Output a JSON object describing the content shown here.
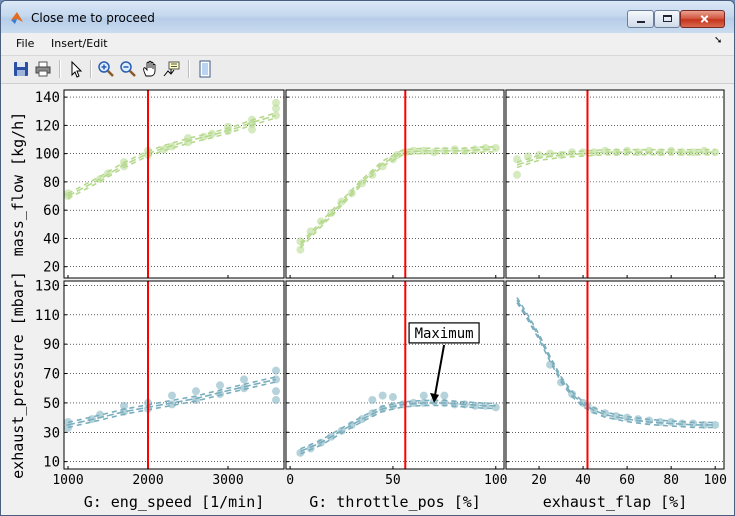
{
  "window": {
    "title": "Close me to proceed"
  },
  "menu": {
    "file": "File",
    "insert_edit": "Insert/Edit",
    "dock_arrow": "➘"
  },
  "toolbar": {
    "icons": [
      "save-icon",
      "print-icon",
      "select-arrow-icon",
      "zoom-in-icon",
      "zoom-out-icon",
      "pan-hand-icon",
      "data-cursor-icon",
      "plot-tools-icon"
    ]
  },
  "colors": {
    "mass_flow": "#b5d98c",
    "exhaust_pressure": "#7aaebe",
    "marker_line": "#ff0000",
    "grid": "#000000"
  },
  "chart_data": [
    {
      "type": "scatter",
      "panel": "top-left",
      "xlabel": "",
      "ylabel": "mass_flow [kg/h]",
      "xlim": [
        950,
        3700
      ],
      "ylim": [
        12,
        145
      ],
      "yticks": [
        20,
        40,
        60,
        80,
        100,
        120,
        140
      ],
      "xticks": [
        1000,
        2000,
        3000
      ],
      "show_xtick_labels": false,
      "marker_x": 2000,
      "series": [
        {
          "x": [
            1000,
            1400,
            1700,
            2000,
            2200,
            2500,
            2800,
            3100,
            3300,
            3600
          ],
          "y": [
            70,
            82,
            92,
            100,
            104,
            109,
            113,
            118,
            122,
            127
          ],
          "kind": "lines"
        }
      ],
      "points": [
        [
          1000,
          70
        ],
        [
          1000,
          72
        ],
        [
          1400,
          82
        ],
        [
          1500,
          86
        ],
        [
          1700,
          91
        ],
        [
          1700,
          94
        ],
        [
          2000,
          99
        ],
        [
          2000,
          102
        ],
        [
          2200,
          103
        ],
        [
          2300,
          105
        ],
        [
          2500,
          108
        ],
        [
          2500,
          111
        ],
        [
          2700,
          112
        ],
        [
          2800,
          114
        ],
        [
          3000,
          116
        ],
        [
          3000,
          119
        ],
        [
          3300,
          121
        ],
        [
          3300,
          124
        ],
        [
          3600,
          127
        ],
        [
          3600,
          132
        ],
        [
          3600,
          136
        ],
        [
          3300,
          117
        ]
      ]
    },
    {
      "type": "scatter",
      "panel": "top-middle",
      "xlabel": "",
      "ylabel": "",
      "xlim": [
        -2,
        104
      ],
      "ylim": [
        12,
        145
      ],
      "xticks": [
        0,
        50,
        100
      ],
      "show_xtick_labels": false,
      "marker_x": 56,
      "series": [
        {
          "x": [
            5,
            15,
            25,
            35,
            45,
            55,
            65,
            75,
            85,
            95,
            100
          ],
          "y": [
            35,
            50,
            65,
            80,
            93,
            101,
            102,
            102,
            102,
            103,
            103
          ],
          "kind": "lines"
        }
      ],
      "points": [
        [
          5,
          32
        ],
        [
          5,
          38
        ],
        [
          10,
          45
        ],
        [
          15,
          52
        ],
        [
          20,
          58
        ],
        [
          25,
          66
        ],
        [
          30,
          72
        ],
        [
          35,
          79
        ],
        [
          40,
          85
        ],
        [
          45,
          91
        ],
        [
          50,
          96
        ],
        [
          52,
          99
        ],
        [
          56,
          101
        ],
        [
          60,
          102
        ],
        [
          65,
          102
        ],
        [
          70,
          101
        ],
        [
          75,
          102
        ],
        [
          80,
          103
        ],
        [
          85,
          102
        ],
        [
          90,
          103
        ],
        [
          95,
          104
        ],
        [
          100,
          104
        ]
      ]
    },
    {
      "type": "scatter",
      "panel": "top-right",
      "xlabel": "",
      "ylabel": "",
      "xlim": [
        5,
        104
      ],
      "ylim": [
        12,
        145
      ],
      "xticks": [
        20,
        40,
        60,
        80,
        100
      ],
      "show_xtick_labels": false,
      "marker_x": 42,
      "series": [
        {
          "x": [
            10,
            20,
            30,
            40,
            50,
            60,
            70,
            80,
            90,
            100
          ],
          "y": [
            92,
            97,
            99,
            100,
            101,
            101,
            101,
            101,
            101,
            101
          ],
          "kind": "lines"
        }
      ],
      "points": [
        [
          10,
          85
        ],
        [
          10,
          96
        ],
        [
          15,
          98
        ],
        [
          20,
          99
        ],
        [
          25,
          100
        ],
        [
          30,
          99
        ],
        [
          35,
          101
        ],
        [
          40,
          101
        ],
        [
          45,
          101
        ],
        [
          50,
          102
        ],
        [
          55,
          101
        ],
        [
          60,
          102
        ],
        [
          65,
          101
        ],
        [
          70,
          102
        ],
        [
          75,
          101
        ],
        [
          80,
          102
        ],
        [
          85,
          101
        ],
        [
          90,
          101
        ],
        [
          95,
          102
        ],
        [
          100,
          101
        ]
      ]
    },
    {
      "type": "scatter",
      "panel": "bottom-left",
      "xlabel": "G: eng_speed [1/min]",
      "ylabel": "exhaust_pressure [mbar]",
      "xlim": [
        950,
        3700
      ],
      "ylim": [
        5,
        133
      ],
      "yticks": [
        10,
        30,
        50,
        70,
        90,
        110,
        130
      ],
      "xticks": [
        1000,
        2000,
        3000
      ],
      "xtick_labels": [
        "1000",
        "2000",
        "3000"
      ],
      "marker_x": 2000,
      "series": [
        {
          "x": [
            1000,
            1400,
            1700,
            2000,
            2300,
            2600,
            2900,
            3200,
            3600
          ],
          "y": [
            35,
            40,
            44,
            47,
            50,
            53,
            57,
            61,
            66
          ],
          "kind": "lines"
        }
      ],
      "points": [
        [
          1000,
          33
        ],
        [
          1000,
          37
        ],
        [
          1300,
          39
        ],
        [
          1400,
          42
        ],
        [
          1700,
          44
        ],
        [
          1700,
          48
        ],
        [
          2000,
          46
        ],
        [
          2000,
          50
        ],
        [
          2300,
          49
        ],
        [
          2300,
          55
        ],
        [
          2600,
          52
        ],
        [
          2600,
          58
        ],
        [
          2900,
          56
        ],
        [
          2900,
          62
        ],
        [
          3200,
          60
        ],
        [
          3200,
          66
        ],
        [
          3600,
          52
        ],
        [
          3600,
          58
        ],
        [
          3600,
          66
        ],
        [
          3600,
          72
        ]
      ]
    },
    {
      "type": "scatter",
      "panel": "bottom-middle",
      "xlabel": "G: throttle_pos [%]",
      "ylabel": "",
      "xlim": [
        -2,
        104
      ],
      "ylim": [
        5,
        133
      ],
      "xticks": [
        0,
        50,
        100
      ],
      "xtick_labels": [
        "0",
        "50",
        "100"
      ],
      "marker_x": 56,
      "annotation": {
        "text": "Maximum",
        "x": 70,
        "y": 50
      },
      "series": [
        {
          "x": [
            5,
            15,
            25,
            35,
            45,
            55,
            65,
            75,
            85,
            95,
            100
          ],
          "y": [
            17,
            23,
            31,
            39,
            46,
            49,
            50,
            50,
            49,
            48,
            48
          ],
          "kind": "lines"
        }
      ],
      "points": [
        [
          5,
          16
        ],
        [
          10,
          19
        ],
        [
          15,
          23
        ],
        [
          20,
          27
        ],
        [
          25,
          31
        ],
        [
          30,
          35
        ],
        [
          35,
          39
        ],
        [
          40,
          43
        ],
        [
          45,
          46
        ],
        [
          50,
          48
        ],
        [
          55,
          49
        ],
        [
          60,
          50
        ],
        [
          65,
          50
        ],
        [
          70,
          51
        ],
        [
          75,
          50
        ],
        [
          80,
          49
        ],
        [
          85,
          49
        ],
        [
          90,
          48
        ],
        [
          95,
          48
        ],
        [
          100,
          47
        ],
        [
          40,
          52
        ],
        [
          45,
          55
        ],
        [
          50,
          54
        ],
        [
          65,
          55
        ],
        [
          75,
          55
        ]
      ]
    },
    {
      "type": "scatter",
      "panel": "bottom-right",
      "xlabel": "exhaust_flap [%]",
      "ylabel": "",
      "xlim": [
        5,
        104
      ],
      "ylim": [
        5,
        133
      ],
      "xticks": [
        20,
        40,
        60,
        80,
        100
      ],
      "xtick_labels": [
        "20",
        "40",
        "60",
        "80",
        "100"
      ],
      "marker_x": 42,
      "series": [
        {
          "x": [
            10,
            15,
            20,
            25,
            30,
            35,
            40,
            45,
            50,
            60,
            70,
            80,
            90,
            100
          ],
          "y": [
            120,
            108,
            95,
            80,
            66,
            56,
            49,
            45,
            42,
            39,
            37,
            36,
            35,
            35
          ],
          "kind": "lines"
        }
      ],
      "points": [
        [
          25,
          76
        ],
        [
          30,
          64
        ],
        [
          35,
          56
        ],
        [
          40,
          50
        ],
        [
          42,
          48
        ],
        [
          45,
          45
        ],
        [
          50,
          43
        ],
        [
          55,
          41
        ],
        [
          60,
          40
        ],
        [
          65,
          39
        ],
        [
          70,
          38
        ],
        [
          75,
          37
        ],
        [
          80,
          37
        ],
        [
          85,
          36
        ],
        [
          90,
          36
        ],
        [
          95,
          35
        ],
        [
          100,
          35
        ]
      ]
    }
  ]
}
